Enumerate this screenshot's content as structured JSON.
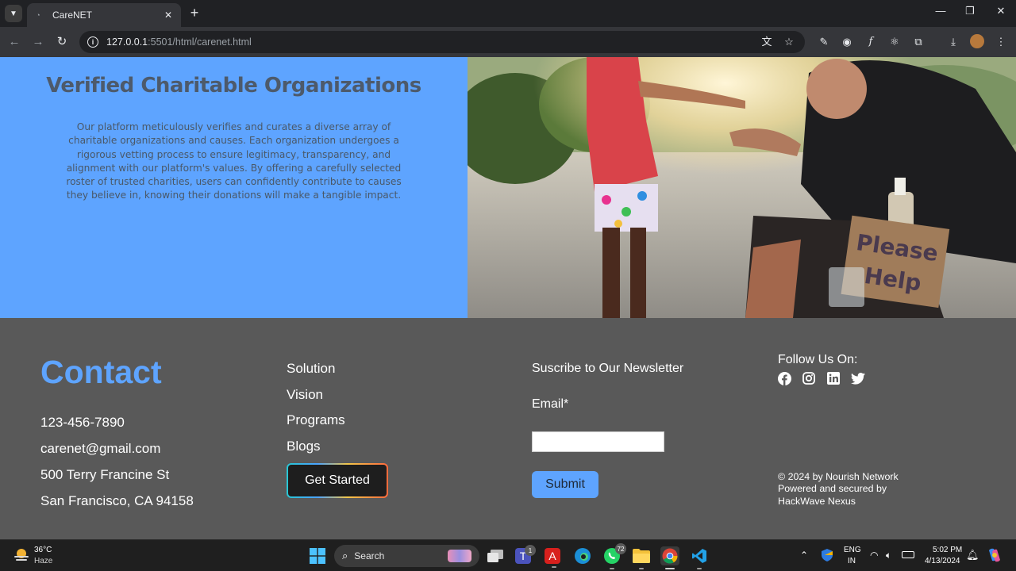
{
  "browser": {
    "tab_title": "CareNET",
    "url_host": "127.0.0.1",
    "url_rest": ":5501/html/carenet.html"
  },
  "hero": {
    "title": "Verified Charitable Organizations",
    "body": "Our platform meticulously verifies and curates a diverse array of charitable organizations and causes. Each organization undergoes a rigorous vetting process to ensure legitimacy, transparency, and alignment with our platform's values. By offering a carefully selected roster of trusted charities, users can confidently contribute to causes they believe in, knowing their donations will make a tangible impact.",
    "photo_sign_text": "Please Help"
  },
  "footer": {
    "contact_title": "Contact",
    "contact_lines": [
      "123-456-7890",
      "carenet@gmail.com",
      "500 Terry Francine St",
      "San Francisco, CA 94158"
    ],
    "links": [
      "Solution",
      "Vision",
      "Programs",
      "Blogs"
    ],
    "cta_label": "Get Started",
    "newsletter_title": "Suscribe to Our Newsletter",
    "email_label": "Email*",
    "email_value": "",
    "submit_label": "Submit",
    "follow_title": "Follow Us On:",
    "social": [
      "facebook-icon",
      "instagram-icon",
      "linkedin-icon",
      "twitter-icon"
    ],
    "copyright": "© 2024 by Nourish Network Powered and secured by HackWave Nexus"
  },
  "taskbar": {
    "weather_temp": "36°C",
    "weather_desc": "Haze",
    "search_label": "Search",
    "teams_badge": "1",
    "whatsapp_badge": "72",
    "lang_top": "ENG",
    "lang_bottom": "IN",
    "time": "5:02 PM",
    "date": "4/13/2024"
  },
  "colors": {
    "hero_bg": "#5ea4ff",
    "footer_bg": "#595959",
    "accent": "#5ea4ff"
  }
}
